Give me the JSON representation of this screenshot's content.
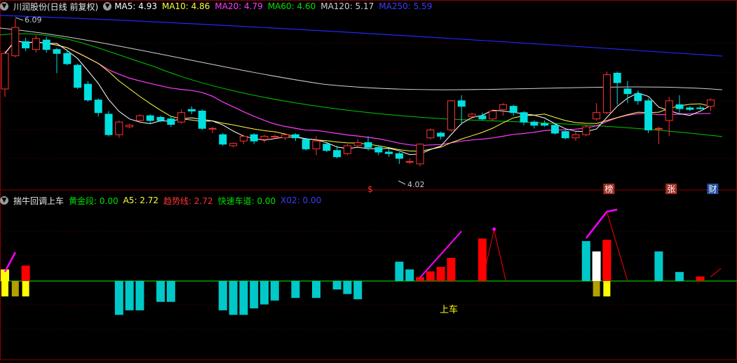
{
  "colors": {
    "up": "#ff3232",
    "down": "#00e0e0",
    "ma5": "#ffffff",
    "ma10": "#ffff3c",
    "ma20": "#ff3cff",
    "ma60": "#00c800",
    "ma120": "#d0d0d0",
    "ma250": "#2424ff",
    "grid": "#5a0000",
    "border": "#8b0000",
    "zero": "#00a000",
    "bar_pos": "#ff0000",
    "bar_neg": "#00c8c8",
    "magenta": "#ff00ff",
    "gold": "#ffff00",
    "white": "#ffffff",
    "text_gray": "#c8c8c8"
  },
  "top_header": {
    "icon": "circle-down-icon",
    "title": "川润股份(日线 前复权)",
    "ma5_label": "MA5: 4.93",
    "ma10_label": "MA10: 4.86",
    "ma20_label": "MA20: 4.79",
    "ma60_label": "MA60: 4.60",
    "ma120_label": "MA120: 5.17",
    "ma250_label": "MA250: 5.59"
  },
  "bottom_header": {
    "icon": "circle-down-icon",
    "title": "揣牛回调上车",
    "gold_label": "黄金段: 0.00",
    "a5_label": "A5: 2.72",
    "trend_label": "趋势线: 2.72",
    "fast_label": "快速车道: 0.00",
    "x02_label": "X02: 0.00"
  },
  "chart_data": [
    {
      "type": "candlestick",
      "price_range": [
        4.0,
        6.15
      ],
      "max_annotation": "6.09",
      "min_annotation": "4.02",
      "moving_averages": [
        "MA5",
        "MA10",
        "MA20",
        "MA60",
        "MA120",
        "MA250"
      ],
      "markers": [
        {
          "text": "$",
          "index": 35
        },
        {
          "text": "榜",
          "index": 58
        },
        {
          "text": "张",
          "index": 64
        },
        {
          "text": "财",
          "index": 68
        }
      ],
      "candles": [
        [
          5.2,
          5.65,
          5.1,
          5.68
        ],
        [
          5.62,
          5.98,
          5.6,
          6.09
        ],
        [
          5.8,
          5.72,
          5.68,
          5.85
        ],
        [
          5.7,
          5.84,
          5.66,
          5.88
        ],
        [
          5.82,
          5.7,
          5.66,
          5.86
        ],
        [
          5.7,
          5.65,
          5.4,
          5.72
        ],
        [
          5.65,
          5.52,
          5.5,
          5.7
        ],
        [
          5.5,
          5.22,
          5.2,
          5.52
        ],
        [
          5.26,
          5.06,
          5.04,
          5.3
        ],
        [
          5.06,
          4.9,
          4.85,
          5.08
        ],
        [
          4.88,
          4.62,
          4.6,
          4.92
        ],
        [
          4.62,
          4.78,
          4.58,
          4.8
        ],
        [
          4.72,
          4.74,
          4.7,
          4.76
        ],
        [
          4.8,
          4.86,
          4.78,
          4.88
        ],
        [
          4.86,
          4.8,
          4.76,
          4.88
        ],
        [
          4.84,
          4.8,
          4.78,
          4.86
        ],
        [
          4.82,
          4.75,
          4.72,
          4.86
        ],
        [
          4.78,
          4.9,
          4.76,
          4.94
        ],
        [
          4.94,
          4.92,
          4.88,
          4.98
        ],
        [
          4.92,
          4.7,
          4.68,
          4.94
        ],
        [
          4.7,
          4.7,
          4.64,
          4.72
        ],
        [
          4.62,
          4.5,
          4.48,
          4.64
        ],
        [
          4.48,
          4.51,
          4.46,
          4.52
        ],
        [
          4.54,
          4.6,
          4.5,
          4.62
        ],
        [
          4.62,
          4.54,
          4.5,
          4.64
        ],
        [
          4.56,
          4.6,
          4.52,
          4.62
        ],
        [
          4.6,
          4.6,
          4.56,
          4.62
        ],
        [
          4.58,
          4.62,
          4.55,
          4.64
        ],
        [
          4.62,
          4.58,
          4.54,
          4.64
        ],
        [
          4.56,
          4.44,
          4.42,
          4.58
        ],
        [
          4.44,
          4.54,
          4.36,
          4.6
        ],
        [
          4.5,
          4.42,
          4.4,
          4.52
        ],
        [
          4.42,
          4.34,
          4.32,
          4.48
        ],
        [
          4.38,
          4.48,
          4.36,
          4.5
        ],
        [
          4.48,
          4.52,
          4.46,
          4.56
        ],
        [
          4.52,
          4.46,
          4.42,
          4.6
        ],
        [
          4.46,
          4.4,
          4.36,
          4.48
        ],
        [
          4.4,
          4.38,
          4.34,
          4.44
        ],
        [
          4.38,
          4.32,
          4.25,
          4.4
        ],
        [
          4.28,
          4.28,
          4.25,
          4.32
        ],
        [
          4.25,
          4.5,
          4.22,
          4.51
        ],
        [
          4.58,
          4.68,
          4.56,
          4.7
        ],
        [
          4.64,
          4.6,
          4.56,
          4.66
        ],
        [
          4.68,
          5.05,
          4.66,
          5.06
        ],
        [
          5.05,
          4.98,
          4.75,
          5.12
        ],
        [
          4.85,
          4.88,
          4.82,
          4.9
        ],
        [
          4.86,
          4.82,
          4.8,
          4.9
        ],
        [
          4.82,
          4.92,
          4.8,
          4.94
        ],
        [
          4.94,
          5.0,
          4.86,
          5.02
        ],
        [
          4.98,
          4.9,
          4.86,
          5.0
        ],
        [
          4.9,
          4.78,
          4.74,
          4.92
        ],
        [
          4.78,
          4.74,
          4.7,
          4.8
        ],
        [
          4.76,
          4.74,
          4.72,
          4.8
        ],
        [
          4.74,
          4.64,
          4.62,
          4.76
        ],
        [
          4.66,
          4.58,
          4.56,
          4.68
        ],
        [
          4.58,
          4.62,
          4.54,
          4.66
        ],
        [
          4.62,
          4.72,
          4.6,
          4.74
        ],
        [
          4.82,
          4.9,
          4.8,
          5.02
        ],
        [
          4.9,
          5.38,
          4.88,
          5.42
        ],
        [
          5.4,
          5.28,
          5.0,
          5.42
        ],
        [
          5.2,
          5.14,
          5.02,
          5.3
        ],
        [
          5.14,
          5.05,
          5.0,
          5.18
        ],
        [
          5.05,
          4.68,
          4.64,
          5.08
        ],
        [
          4.7,
          4.7,
          4.5,
          4.72
        ],
        [
          4.8,
          5.05,
          4.6,
          5.1
        ],
        [
          5.0,
          4.95,
          4.9,
          5.12
        ],
        [
          4.96,
          4.94,
          4.92,
          4.98
        ],
        [
          4.96,
          4.95,
          4.94,
          4.99
        ],
        [
          4.98,
          5.06,
          4.92,
          5.08
        ]
      ]
    },
    {
      "type": "indicator",
      "title": "揣牛回调上车",
      "y_range": [
        -0.85,
        1.1
      ],
      "bars": [
        0.18,
        0.0,
        0.24,
        0.0,
        0.0,
        0.0,
        0.0,
        0.0,
        0.0,
        0.0,
        0.0,
        -0.52,
        -0.45,
        -0.45,
        0.0,
        -0.32,
        -0.32,
        0.0,
        0.0,
        0.0,
        0.0,
        -0.45,
        -0.52,
        -0.52,
        -0.42,
        -0.36,
        -0.3,
        0.0,
        -0.26,
        0.0,
        -0.26,
        0.0,
        -0.13,
        -0.2,
        -0.28,
        0.0,
        0.0,
        0.0,
        0.3,
        0.18,
        0.06,
        0.15,
        0.22,
        0.36,
        0.0,
        0.0,
        0.66,
        0.0,
        0.0,
        0.0,
        0.0,
        0.0,
        0.0,
        0.0,
        0.0,
        0.0,
        0.62,
        0.46,
        0.64,
        0.0,
        0.0,
        0.0,
        0.0,
        0.46,
        0.0,
        0.14,
        0.0,
        0.07,
        0.0,
        0.0
      ],
      "bar_colors": [
        "gold",
        "none",
        "up",
        "down",
        "none",
        "none",
        "none",
        "none",
        "none",
        "none",
        "none",
        "down",
        "down",
        "down",
        "none",
        "down",
        "down",
        "none",
        "none",
        "none",
        "none",
        "down",
        "down",
        "down",
        "down",
        "down",
        "down",
        "none",
        "down",
        "none",
        "down",
        "none",
        "down",
        "down",
        "down",
        "none",
        "none",
        "none",
        "down",
        "down",
        "up",
        "up",
        "up",
        "up",
        "none",
        "none",
        "up",
        "none",
        "none",
        "none",
        "none",
        "none",
        "none",
        "none",
        "none",
        "none",
        "down",
        "white",
        "up",
        "up",
        "none",
        "none",
        "none",
        "down",
        "none",
        "down",
        "none",
        "up",
        "none",
        "none"
      ],
      "buy_label": "上车"
    }
  ]
}
